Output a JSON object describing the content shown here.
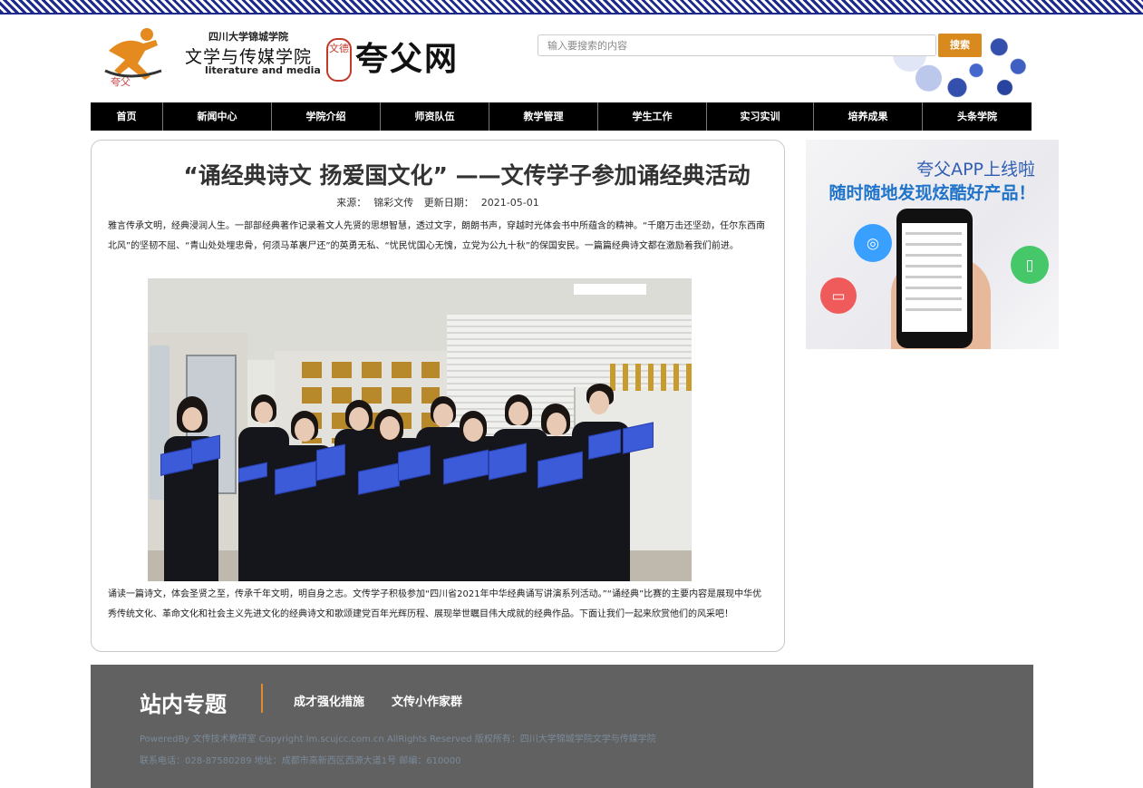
{
  "header": {
    "logo_small_text": "夸父",
    "school_name": "四川大学锦城学院",
    "college_name": "文学与传媒学院",
    "college_name_en": "literature and media",
    "seal_text": "文德",
    "brand_name": "夸父网",
    "search_placeholder": "输入要搜索的内容",
    "search_button": "搜索"
  },
  "nav": {
    "items": [
      {
        "label": "首页"
      },
      {
        "label": "新闻中心"
      },
      {
        "label": "学院介绍"
      },
      {
        "label": "师资队伍"
      },
      {
        "label": "教学管理"
      },
      {
        "label": "学生工作"
      },
      {
        "label": "实习实训"
      },
      {
        "label": "培养成果"
      },
      {
        "label": "头条学院"
      }
    ]
  },
  "article": {
    "title": "“诵经典诗文 扬爱国文化” ——文传学子参加诵经典活动",
    "source_label": "来源：",
    "source_value": "锦彩文传",
    "date_label": "更新日期：",
    "date_value": "2021-05-01",
    "paragraph1": "雅言传承文明，经典浸润人生。一部部经典著作记录着文人先贤的思想智慧，透过文字，朗朗书声，穿越时光体会书中所蕴含的精神。“千磨万击还坚劲，任尔东西南北风”的坚韧不屈、“青山处处埋忠骨，何须马革裹尸还”的英勇无私、“忧民忧国心无愧，立党为公九十秋”的保国安民。一篇篇经典诗文都在激励着我们前进。",
    "paragraph2": "诵读一篇诗文，体会圣贤之至，传承千年文明，明自身之志。文传学子积极参加“四川省2021年中华经典诵写讲演系列活动。”“诵经典”比赛的主要内容是展现中华优秀传统文化、革命文化和社会主义先进文化的经典诗文和歌颂建党百年光辉历程、展现举世瞩目伟大成就的经典作品。下面让我们一起来欣赏他们的风采吧！"
  },
  "ad": {
    "line1": "夸父APP上线啦",
    "line2": "随时随地发现炫酷好产品！"
  },
  "footer": {
    "title": "站内专题",
    "link1": "成才强化措施",
    "link2": "文传小作家群",
    "copyright": "PoweredBy 文传技术教研室 Copyright lm.scujcc.com.cn AllRights Reserved 版权所有：四川大学锦城学院文学与传媒学院",
    "contact": "联系电话：028-87580289 地址：成都市高新西区西源大道1号 邮编：610000"
  },
  "colors": {
    "accent": "#d98a1e",
    "nav_bg": "#000000",
    "footer_bg": "#616161",
    "pattern": "#1d2a8c"
  }
}
